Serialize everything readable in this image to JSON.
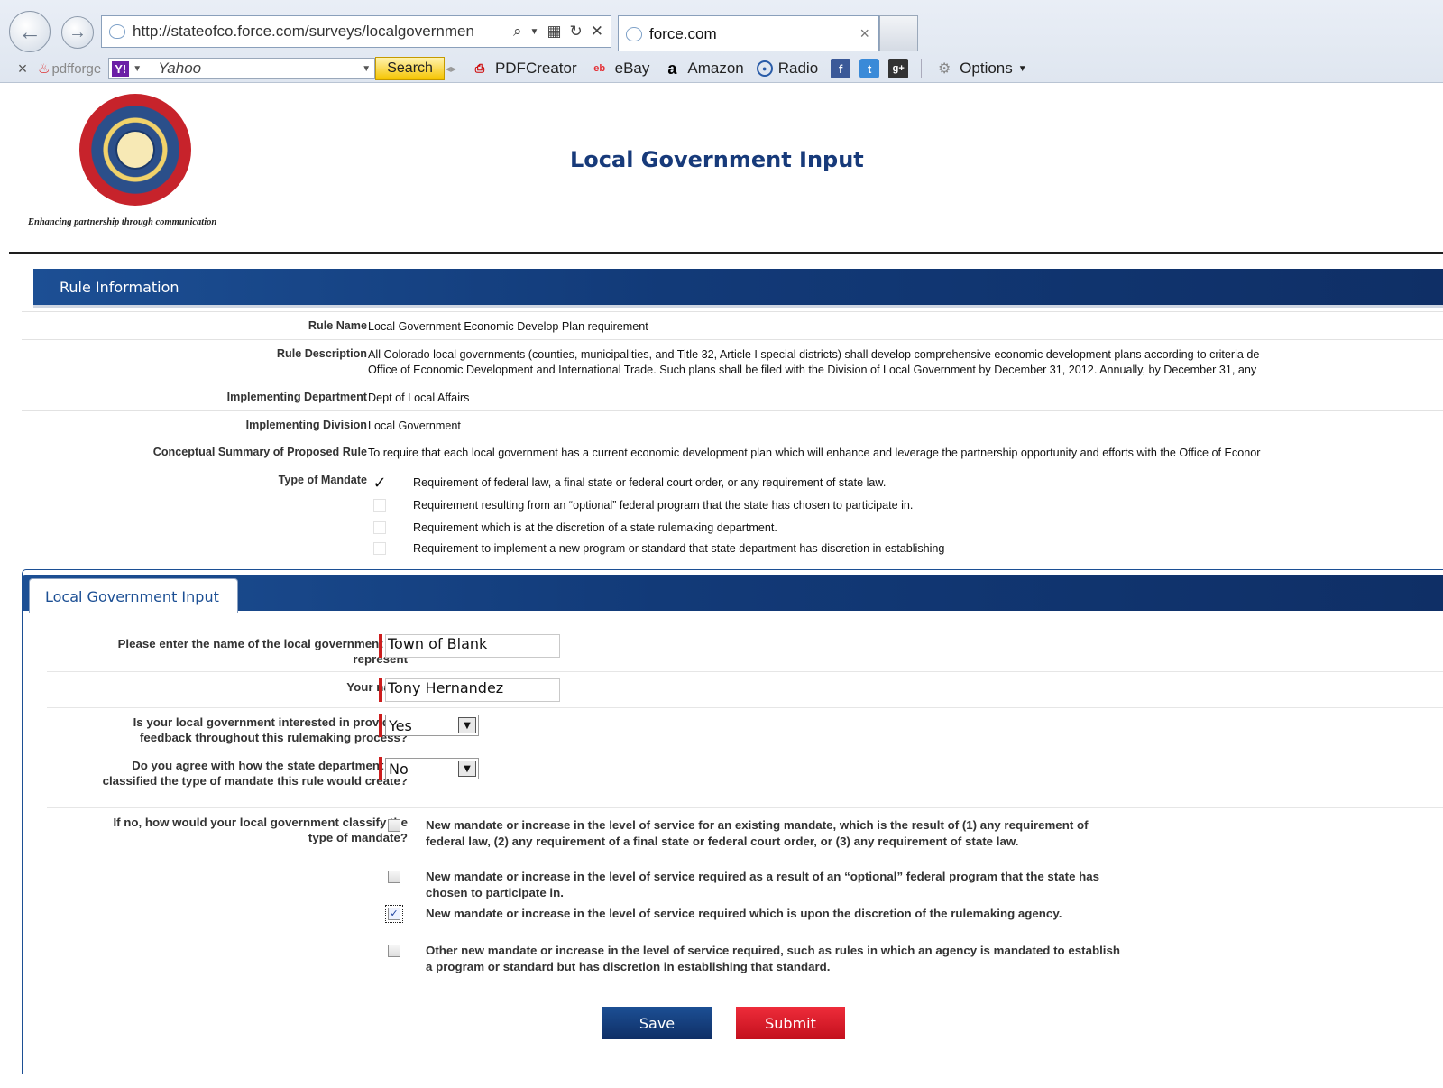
{
  "browser": {
    "url": "http://stateofco.force.com/surveys/localgovernmen",
    "tab_title": "force.com",
    "tab_close": "×",
    "back_icon": "←",
    "forward_icon": "→",
    "toolbar": {
      "close": "×",
      "pdfforge": "pdfforge",
      "yahoo_logo": "Y!",
      "yahoo_placeholder": "Yahoo",
      "search_label": "Search",
      "items": {
        "pdfcreator": "PDFCreator",
        "ebay": "eBay",
        "amazon": "Amazon",
        "radio": "Radio",
        "options": "Options"
      }
    }
  },
  "header": {
    "tagline": "Enhancing partnership through communication",
    "title": "Local Government Input"
  },
  "rule_info": {
    "section_title": "Rule Information",
    "rows": [
      {
        "label": "Rule Name",
        "value": "Local Government Economic Develop Plan requirement"
      },
      {
        "label": "Rule Description",
        "value_line1": "All Colorado local governments (counties, municipalities, and Title 32, Article I special districts) shall develop comprehensive economic development plans according to criteria de",
        "value_line2": "Office of Economic Development and International Trade. Such plans shall be filed with the Division of Local Government by December 31, 2012. Annually, by December 31, any"
      },
      {
        "label": "Implementing Department",
        "value": "Dept of Local Affairs"
      },
      {
        "label": "Implementing Division",
        "value": "Local Government"
      },
      {
        "label": "Conceptual Summary of Proposed Rule",
        "value": "To require that each local government has a current economic development plan which will enhance and leverage the partnership opportunity and efforts with the Office of Econor"
      }
    ],
    "mandate": {
      "label": "Type of Mandate",
      "check_mark": "✓",
      "options": [
        "Requirement of federal law, a final state or federal court order, or any requirement of state law.",
        "Requirement resulting from an “optional” federal program that the state has chosen to participate in.",
        "Requirement which is at the discretion of a state rulemaking department.",
        "Requirement to implement a new program or standard that state department has discretion in establishing"
      ]
    }
  },
  "lg_input": {
    "tab_title": "Local Government Input",
    "fields": {
      "gov_name_label": "Please enter the name of the local government you represent",
      "gov_name_value": "Town of Blank",
      "your_name_label": "Your name",
      "your_name_value": "Tony Hernandez",
      "interested_label": "Is your local government interested in providing feedback throughout this rulemaking process?",
      "interested_value": "Yes",
      "agree_label": "Do you agree with how the state department has classified the type of mandate this rule would create?",
      "agree_value": "No",
      "classify_label": "If no, how would your local government classify the type of mandate?"
    },
    "classify_options": [
      "New mandate or increase in the level of service for an existing mandate, which is the result of (1) any requirement of federal law, (2) any requirement of a final state or federal court order, or (3) any requirement of state law.",
      "New mandate or increase in the level of service required as a result of an “optional” federal program that the state has chosen to participate in.",
      "New mandate or increase in the level of service required which is upon the discretion of the rulemaking agency.",
      "Other new mandate or increase in the level of service required, such as rules in which an agency is mandated to establish a program or standard but has discretion in establishing that standard."
    ],
    "checked_mark": "✓",
    "select_arrow": "▼",
    "save_label": "Save",
    "submit_label": "Submit"
  }
}
